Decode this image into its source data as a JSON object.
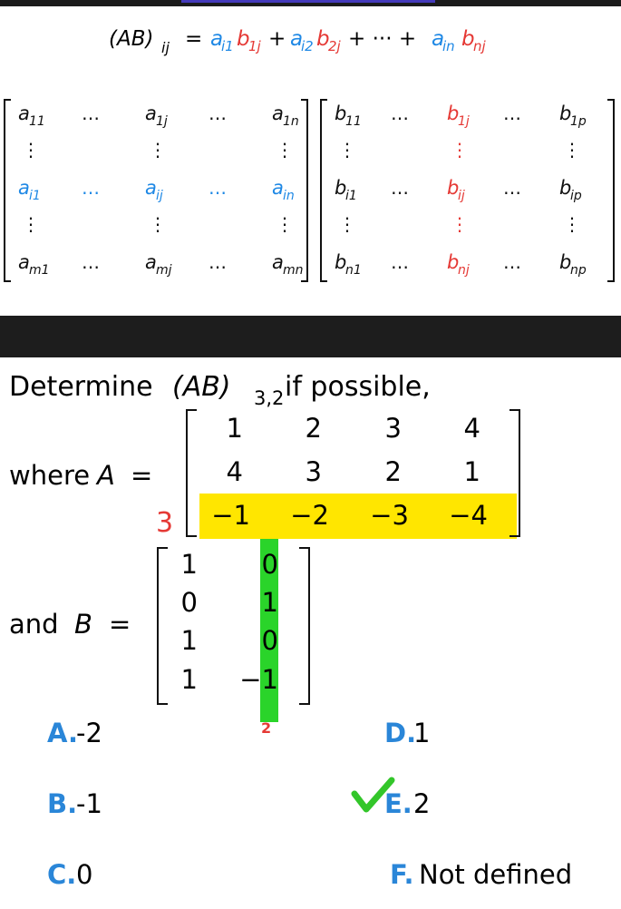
{
  "formula": {
    "lhs": "(AB)",
    "lhs_sub": "ij",
    "eq": "=",
    "t1a": "a",
    "t1a_sub": "i1",
    "t1b": "b",
    "t1b_sub": "1j",
    "plus1": "+",
    "t2a": "a",
    "t2a_sub": "i2",
    "t2b": "b",
    "t2b_sub": "2j",
    "plus2": "+ ··· +",
    "tna": "a",
    "tna_sub": "in",
    "tnb": "b",
    "tnb_sub": "nj"
  },
  "matrix_a": {
    "rows": [
      [
        {
          "b": "a",
          "s": "11"
        },
        "…",
        {
          "b": "a",
          "s": "1j"
        },
        "…",
        {
          "b": "a",
          "s": "1n"
        }
      ],
      [
        "⋮",
        "",
        "⋮",
        "",
        "⋮"
      ],
      [
        {
          "b": "a",
          "s": "i1"
        },
        "…",
        {
          "b": "a",
          "s": "ij"
        },
        "…",
        {
          "b": "a",
          "s": "in"
        }
      ],
      [
        "⋮",
        "",
        "⋮",
        "",
        "⋮"
      ],
      [
        {
          "b": "a",
          "s": "m1"
        },
        "…",
        {
          "b": "a",
          "s": "mj"
        },
        "…",
        {
          "b": "a",
          "s": "mn"
        }
      ]
    ]
  },
  "matrix_b": {
    "rows": [
      [
        {
          "b": "b",
          "s": "11"
        },
        "…",
        {
          "b": "b",
          "s": "1j"
        },
        "…",
        {
          "b": "b",
          "s": "1p"
        }
      ],
      [
        "⋮",
        "",
        "⋮",
        "",
        "⋮"
      ],
      [
        {
          "b": "b",
          "s": "i1"
        },
        "…",
        {
          "b": "b",
          "s": "ij"
        },
        "…",
        {
          "b": "b",
          "s": "ip"
        }
      ],
      [
        "⋮",
        "",
        "⋮",
        "",
        "⋮"
      ],
      [
        {
          "b": "b",
          "s": "n1"
        },
        "…",
        {
          "b": "b",
          "s": "nj"
        },
        "…",
        {
          "b": "b",
          "s": "np"
        }
      ]
    ]
  },
  "question": {
    "prompt_pre": "Determine ",
    "prompt_expr": "(AB)",
    "prompt_sub": "3,2",
    "prompt_post": " if possible,",
    "where": "where ",
    "a_name": "A",
    "and": "and ",
    "b_name": "B",
    "equals": "=",
    "matrix_a": [
      [
        "1",
        "2",
        "3",
        "4"
      ],
      [
        "4",
        "3",
        "2",
        "1"
      ],
      [
        "−1",
        "−2",
        "−3",
        "−4"
      ]
    ],
    "matrix_b": [
      [
        "1",
        "0"
      ],
      [
        "0",
        "1"
      ],
      [
        "1",
        "0"
      ],
      [
        "1",
        "−1"
      ]
    ],
    "row_mark": "3",
    "col_mark": "2"
  },
  "choices": [
    {
      "letter": "A.",
      "text": "-2"
    },
    {
      "letter": "B.",
      "text": "-1"
    },
    {
      "letter": "C.",
      "text": "0"
    },
    {
      "letter": "D.",
      "text": "1"
    },
    {
      "letter": "E.",
      "text": "2"
    },
    {
      "letter": "F.",
      "text": "Not defined"
    }
  ],
  "correct_choice": "E.",
  "colors": {
    "blue": "#1e88e5",
    "red": "#e53935",
    "highlight_yellow": "#ffe600",
    "highlight_green": "#2ad42a",
    "check_green": "#33c62a",
    "letter_blue": "#2a86d8",
    "dark_bar": "#1d1d1d"
  }
}
